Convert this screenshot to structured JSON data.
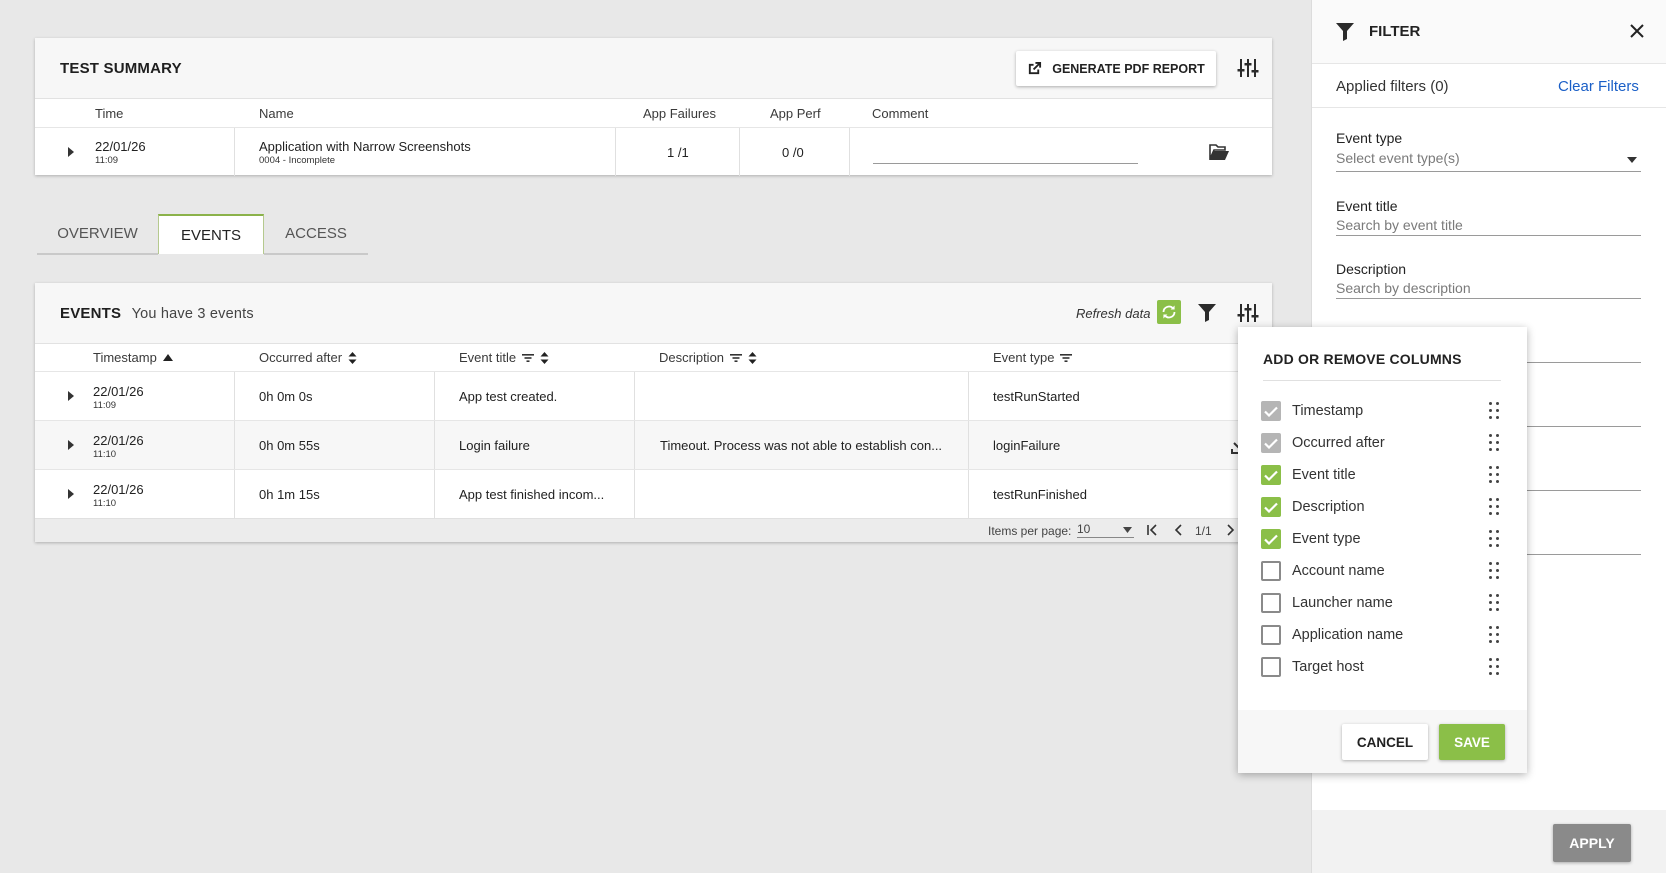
{
  "summary": {
    "title": "TEST SUMMARY",
    "pdf_button": "GENERATE PDF REPORT",
    "columns": {
      "time": "Time",
      "name": "Name",
      "app_failures": "App Failures",
      "app_perf": "App Perf",
      "comment": "Comment"
    },
    "row": {
      "date": "22/01/26",
      "time": "11:09",
      "name": "Application with Narrow Screenshots",
      "sub": "0004 - Incomplete",
      "app_failures": "1 /1",
      "app_perf": "0 /0"
    }
  },
  "tabs": [
    {
      "label": "OVERVIEW",
      "active": false
    },
    {
      "label": "EVENTS",
      "active": true
    },
    {
      "label": "ACCESS",
      "active": false
    }
  ],
  "events": {
    "title": "EVENTS",
    "count_text": "You have 3 events",
    "refresh_label": "Refresh data",
    "columns": {
      "timestamp": "Timestamp",
      "occurred_after": "Occurred after",
      "event_title": "Event title",
      "description": "Description",
      "event_type": "Event type"
    },
    "rows": [
      {
        "date": "22/01/26",
        "time": "11:09",
        "occurred": "0h 0m 0s",
        "title": "App test created.",
        "description": "",
        "type": "testRunStarted"
      },
      {
        "date": "22/01/26",
        "time": "11:10",
        "occurred": "0h 0m 55s",
        "title": "Login failure",
        "description": "Timeout. Process was not able to establish con...",
        "type": "loginFailure"
      },
      {
        "date": "22/01/26",
        "time": "11:10",
        "occurred": "0h 1m 15s",
        "title": "App test finished incom...",
        "description": "",
        "type": "testRunFinished"
      }
    ],
    "pagination": {
      "items_label": "Items per page:",
      "items_value": "10",
      "page": "1/1"
    }
  },
  "filter_panel": {
    "title": "FILTER",
    "applied": "Applied filters (0)",
    "clear": "Clear Filters",
    "fields": {
      "event_type_label": "Event type",
      "event_type_placeholder": "Select event type(s)",
      "event_title_label": "Event title",
      "event_title_placeholder": "Search by event title",
      "description_label": "Description",
      "description_placeholder": "Search by description"
    },
    "apply": "APPLY"
  },
  "columns_popup": {
    "title": "ADD OR REMOVE COLUMNS",
    "items": [
      {
        "label": "Timestamp",
        "state": "locked"
      },
      {
        "label": "Occurred after",
        "state": "locked"
      },
      {
        "label": "Event title",
        "state": "checked"
      },
      {
        "label": "Description",
        "state": "checked"
      },
      {
        "label": "Event type",
        "state": "checked"
      },
      {
        "label": "Account name",
        "state": "unchecked"
      },
      {
        "label": "Launcher name",
        "state": "unchecked"
      },
      {
        "label": "Application name",
        "state": "unchecked"
      },
      {
        "label": "Target host",
        "state": "unchecked"
      }
    ],
    "cancel": "CANCEL",
    "save": "SAVE"
  },
  "colors": {
    "accent_green": "#8bbf48",
    "link_blue": "#1a5fc7",
    "apply_grey": "#8a8a8a"
  }
}
